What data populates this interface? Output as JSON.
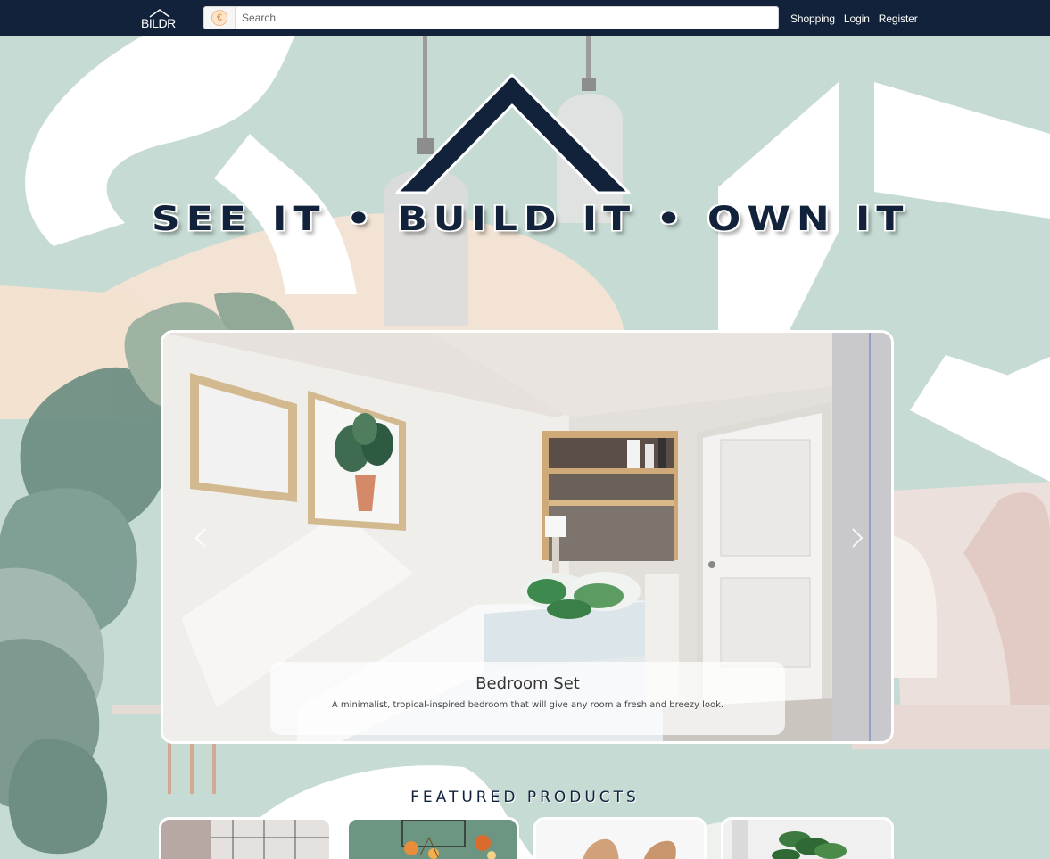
{
  "navbar": {
    "logo_text": "BILDR",
    "search": {
      "placeholder": "Search",
      "icon": "coin-icon"
    },
    "links": [
      "Shopping",
      "Login",
      "Register"
    ],
    "bg_color": "#12223a"
  },
  "hero": {
    "tagline": "SEE IT • BUILD IT • OWN IT",
    "text_color": "#12223a"
  },
  "carousel": {
    "slide_title": "Bedroom Set",
    "slide_description": "A minimalist, tropical-inspired bedroom that will give any room a fresh and breezy look.",
    "prev_icon": "chevron-left-icon",
    "next_icon": "chevron-right-icon"
  },
  "featured": {
    "title": "FEATURED PRODUCTS",
    "products": [
      "product-1",
      "product-2",
      "product-3",
      "product-4"
    ]
  }
}
